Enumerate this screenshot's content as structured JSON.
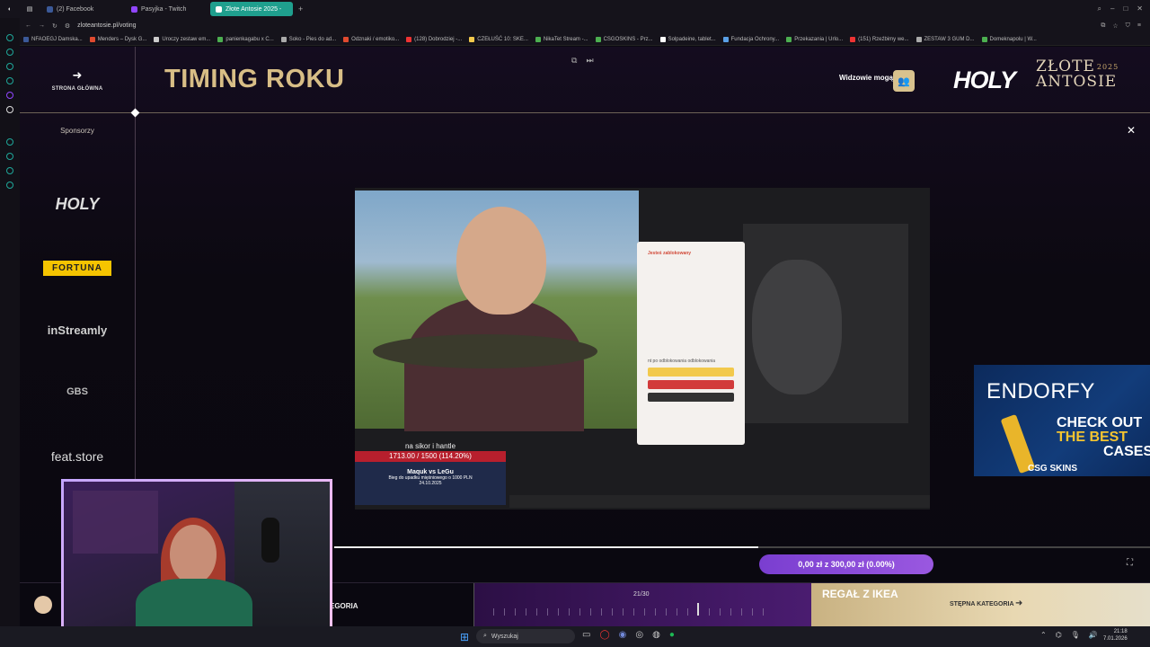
{
  "browser": {
    "tabs": [
      {
        "label": "(2) Facebook"
      },
      {
        "label": "Pasyjka - Twitch"
      },
      {
        "label": "Złote Antosie 2025 - "
      }
    ],
    "url": "zloteantosie.pl/voting",
    "bookmarks": [
      "NFAOEGJ Damska...",
      "Menders – Dysk G...",
      "Uroczy zestaw em...",
      "panienkagabu x C...",
      "Soko - Pies do ad...",
      "Odznaki / emotiko...",
      "(128) Dobrodziej -...",
      "CZEŁUŚĆ 10: SKE...",
      "NikaTet Stream -...",
      "CSGOSKINS - Prz...",
      "Solpadeine, tablet...",
      "Fundacja Ochrony...",
      "Przekazania | Urlo...",
      "(151) Rzeźbimy we...",
      "ZESTAW 3 GUM D...",
      "Domeknapolu | W..."
    ]
  },
  "header": {
    "home_label": "STRONA GŁÓWNA",
    "title": "TIMING ROKU",
    "viewers_label": "Widzowie mogą",
    "logo_main": "HOLY",
    "logo_script_1": "ZŁOTE",
    "logo_script_2": "ANTOSIE",
    "logo_year": "2025"
  },
  "sidebar": {
    "label": "Sponsorzy",
    "sponsors": [
      "HOLY",
      "FORTUNA",
      "inStreamly",
      "GBS",
      "feat.store"
    ]
  },
  "video": {
    "dialog_title": "Jesteś zablokowany",
    "dialog_footer": "nt po odblokowania odblokowania",
    "stream_title": "na sikor i hantle",
    "goal_text": "1713.00 / 1500 (114.20%)",
    "promo_title": "Maquk vs LeGu",
    "promo_sub": "Bieg do upadku mięśniowego o 1000 PLN",
    "promo_date": "24.10.2025",
    "progress": 0.52
  },
  "ad": {
    "brand": "ENDORFY",
    "line1": "CHECK OUT",
    "line2": "THE BEST",
    "line3": "CASES",
    "footer": "CSG SKINS"
  },
  "bottom": {
    "category_tail": "EGORIA",
    "counter": "21/30",
    "reward_title": "REGAŁ Z IKEA",
    "pill": "0,00 zł z 300,00 zł (0.00%)",
    "next_label": "STĘPNA KATEGORIA"
  },
  "taskbar": {
    "search_placeholder": "Wyszukaj",
    "time": "21:18",
    "date": "7.01.2026"
  }
}
